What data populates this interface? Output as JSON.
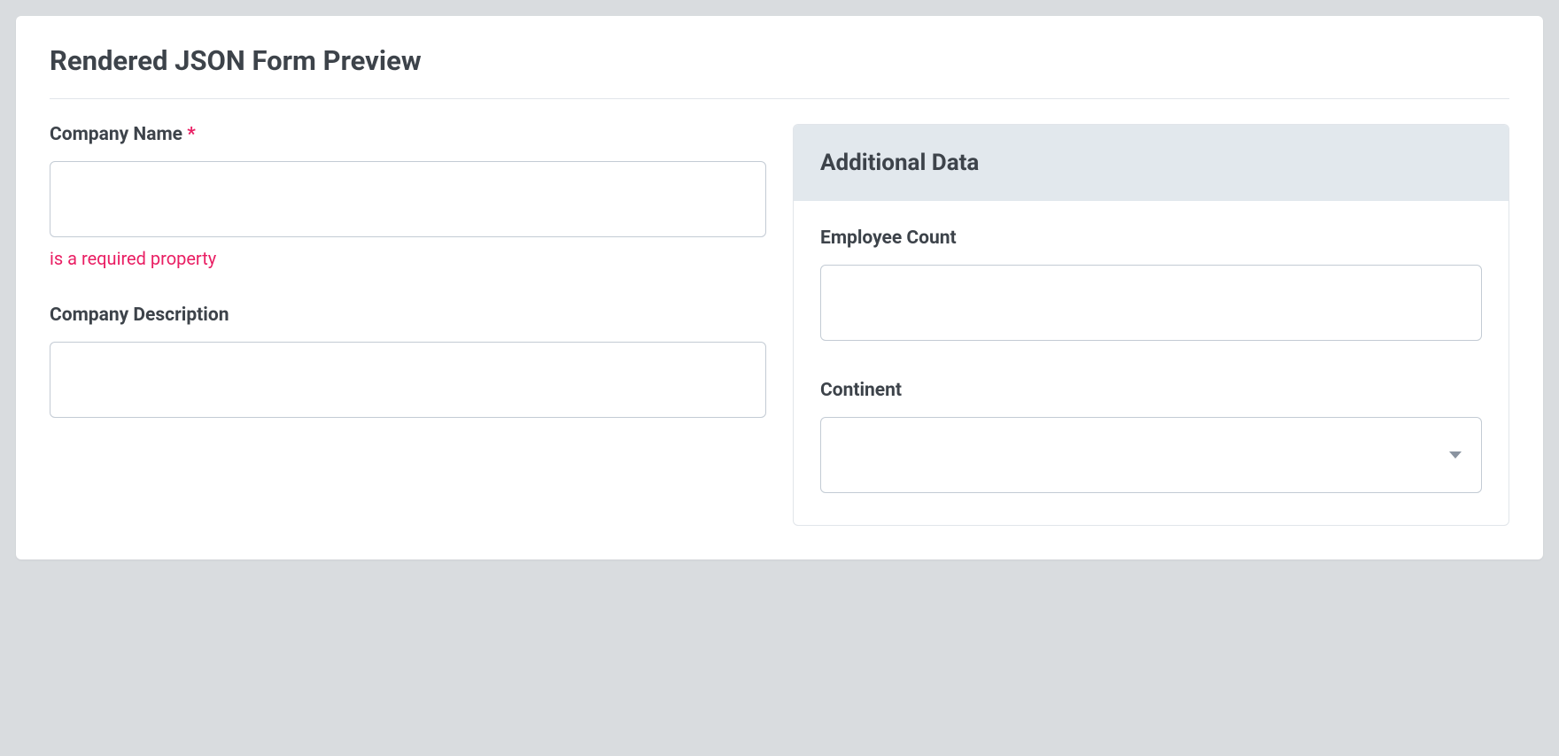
{
  "header": {
    "title": "Rendered JSON Form Preview"
  },
  "left": {
    "company_name": {
      "label": "Company Name",
      "required_mark": "*",
      "value": "",
      "error": "is a required property"
    },
    "company_description": {
      "label": "Company Description",
      "value": ""
    }
  },
  "panel": {
    "title": "Additional Data",
    "employee_count": {
      "label": "Employee Count",
      "value": ""
    },
    "continent": {
      "label": "Continent",
      "value": ""
    }
  }
}
